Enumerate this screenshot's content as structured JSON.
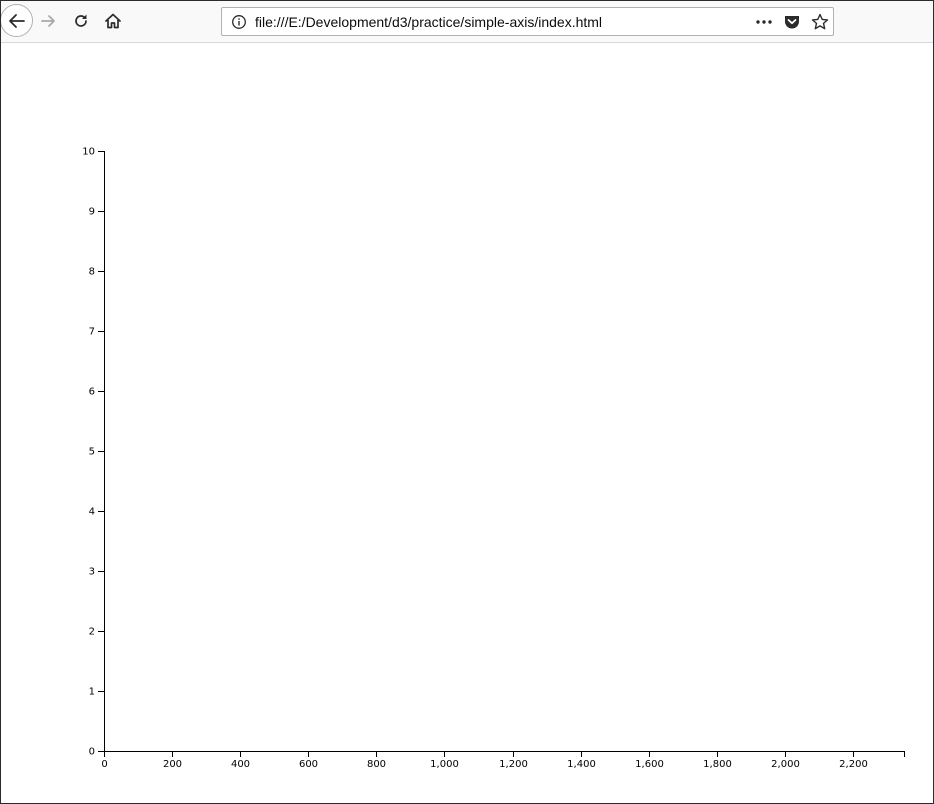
{
  "browser": {
    "url": "file:///E:/Development/d3/practice/simple-axis/index.html",
    "icons": {
      "back": "back-arrow-icon",
      "forward": "forward-arrow-icon",
      "reload": "reload-icon",
      "home": "home-icon",
      "info": "info-icon",
      "more": "more-dots-icon",
      "pocket": "pocket-icon",
      "bookmark": "star-icon"
    }
  },
  "chart_data": {
    "type": "scatter",
    "title": "",
    "xlabel": "",
    "ylabel": "",
    "x": [],
    "y": [],
    "xlim": [
      0,
      2350
    ],
    "ylim": [
      0,
      10
    ],
    "x_ticks": [
      0,
      200,
      400,
      600,
      800,
      1000,
      1200,
      1400,
      1600,
      1800,
      2000,
      2200
    ],
    "x_tick_labels": [
      "0",
      "200",
      "400",
      "600",
      "800",
      "1,000",
      "1,200",
      "1,400",
      "1,600",
      "1,800",
      "2,000",
      "2,200"
    ],
    "y_ticks": [
      0,
      1,
      2,
      3,
      4,
      5,
      6,
      7,
      8,
      9,
      10
    ],
    "y_tick_labels": [
      "0",
      "1",
      "2",
      "3",
      "4",
      "5",
      "6",
      "7",
      "8",
      "9",
      "10"
    ],
    "grid": false,
    "legend": "none"
  }
}
